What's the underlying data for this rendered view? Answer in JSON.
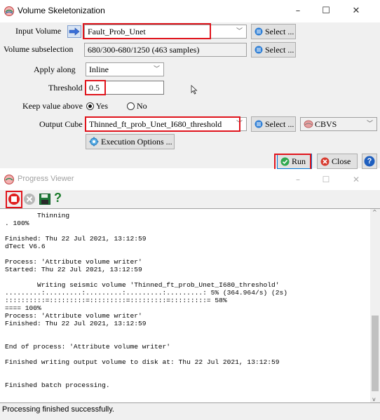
{
  "dialog": {
    "title": "Volume Skeletonization",
    "window_controls": {
      "minimize": "–",
      "maximize": "☐",
      "close": "✕"
    },
    "input_volume": {
      "label": "Input Volume",
      "value": "Fault_Prob_Unet"
    },
    "volume_subselection": {
      "label": "Volume subselection",
      "value": "680/300-680/1250 (463 samples)"
    },
    "select_label": "Select ...",
    "apply_along": {
      "label": "Apply along",
      "value": "Inline"
    },
    "threshold": {
      "label": "Threshold",
      "value": "0.5"
    },
    "keep_value_above": {
      "label": "Keep value above",
      "yes": "Yes",
      "no": "No",
      "selected": "Yes"
    },
    "output_cube": {
      "label": "Output Cube",
      "value": "Thinned_ft_prob_Unet_I680_threshold",
      "storage": "CBVS"
    },
    "execution_options": "Execution Options ...",
    "run": "Run",
    "close": "Close",
    "help": "?"
  },
  "progress": {
    "title": "Progress Viewer",
    "window_controls": {
      "minimize": "–",
      "maximize": "☐",
      "close": "✕"
    },
    "toolbar_help": "?",
    "log_lines": [
      "        Thinning",
      ". 100%",
      "",
      "Finished: Thu 22 Jul 2021, 13:12:59",
      "dTect V6.6",
      "",
      "Process: 'Attribute volume writer'",
      "Started: Thu 22 Jul 2021, 13:12:59",
      "",
      "        Writing seismic volume 'Thinned_ft_prob_Unet_I680_threshold'",
      ".........:.........:.........:.........:.........: 5% (364.964/s) (2s)",
      "::::::::::=:::::::::=:::::::::=:::::::::=:::::::::= 58%",
      "==== 100%",
      "Process: 'Attribute volume writer'",
      "Finished: Thu 22 Jul 2021, 13:12:59",
      "",
      "",
      "End of process: 'Attribute volume writer'",
      "",
      "Finished writing output volume to disk at: Thu 22 Jul 2021, 13:12:59",
      "",
      "",
      "Finished batch processing.",
      ""
    ],
    "status": "Processing finished successfully."
  }
}
